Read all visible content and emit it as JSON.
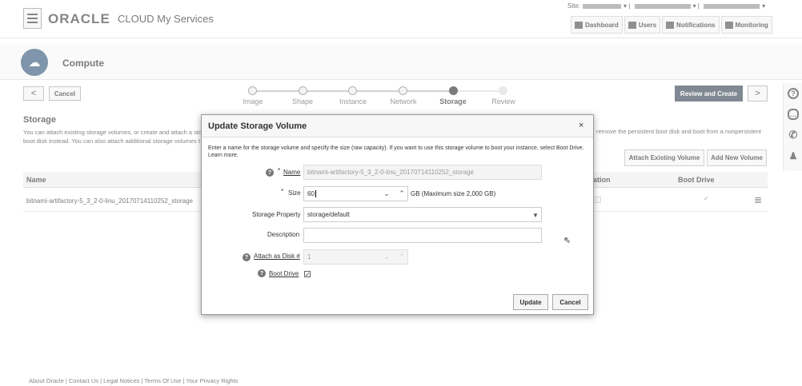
{
  "header": {
    "logo": "ORACLE",
    "product": "CLOUD My Services",
    "site_label": "Site:",
    "nav": [
      {
        "label": "Dashboard",
        "icon": "dashboard-icon"
      },
      {
        "label": "Users",
        "icon": "users-icon"
      },
      {
        "label": "Notifications",
        "icon": "notifications-icon"
      },
      {
        "label": "Monitoring",
        "icon": "monitoring-icon"
      }
    ]
  },
  "service": {
    "title": "Compute"
  },
  "train": {
    "back": "<",
    "cancel": "Cancel",
    "steps": [
      "Image",
      "Shape",
      "Instance",
      "Network",
      "Storage",
      "Review"
    ],
    "active_step": "Storage",
    "review_create": "Review and Create",
    "next": ">"
  },
  "storage": {
    "title": "Storage",
    "desc_left": "You can attach existing storage volumes, or create and attach a sto",
    "desc_left2": "boot disk instead. You can also attach additional storage volumes t",
    "desc_right": "remove the persistent boot disk and boot from a nonpersistent",
    "attach_existing": "Attach Existing Volume",
    "add_new": "Add New Volume",
    "columns": {
      "name": "Name",
      "attach": "ation",
      "boot": "Boot Drive"
    },
    "rows": [
      {
        "name": "bitnami-artifactory-5_3_2-0-linu_20170714110252_storage"
      }
    ]
  },
  "dialog": {
    "title": "Update Storage Volume",
    "close": "×",
    "description": "Enter a name for the storage volume and specify the size (raw capacity). If you want to use this storage volume to boot your instance, select Boot Drive. Learn more.",
    "name_label": "Name",
    "name_value": "bitnami-artifactory-5_3_2-0-linu_20170714110252_storage",
    "size_label": "Size",
    "size_value": "60",
    "size_hint": "GB (Maximum size 2,000 GB)",
    "storage_property_label": "Storage Property",
    "storage_property_value": "storage/default",
    "description_label": "Description",
    "description_value": "",
    "attach_disk_label": "Attach as Disk #",
    "attach_disk_value": "1",
    "boot_drive_label": "Boot Drive",
    "boot_drive_checked": true,
    "update": "Update",
    "cancel": "Cancel"
  },
  "footer": {
    "text": "About Oracle | Contact Us | Legal Notices | Terms Of Use | Your Privacy Rights"
  }
}
